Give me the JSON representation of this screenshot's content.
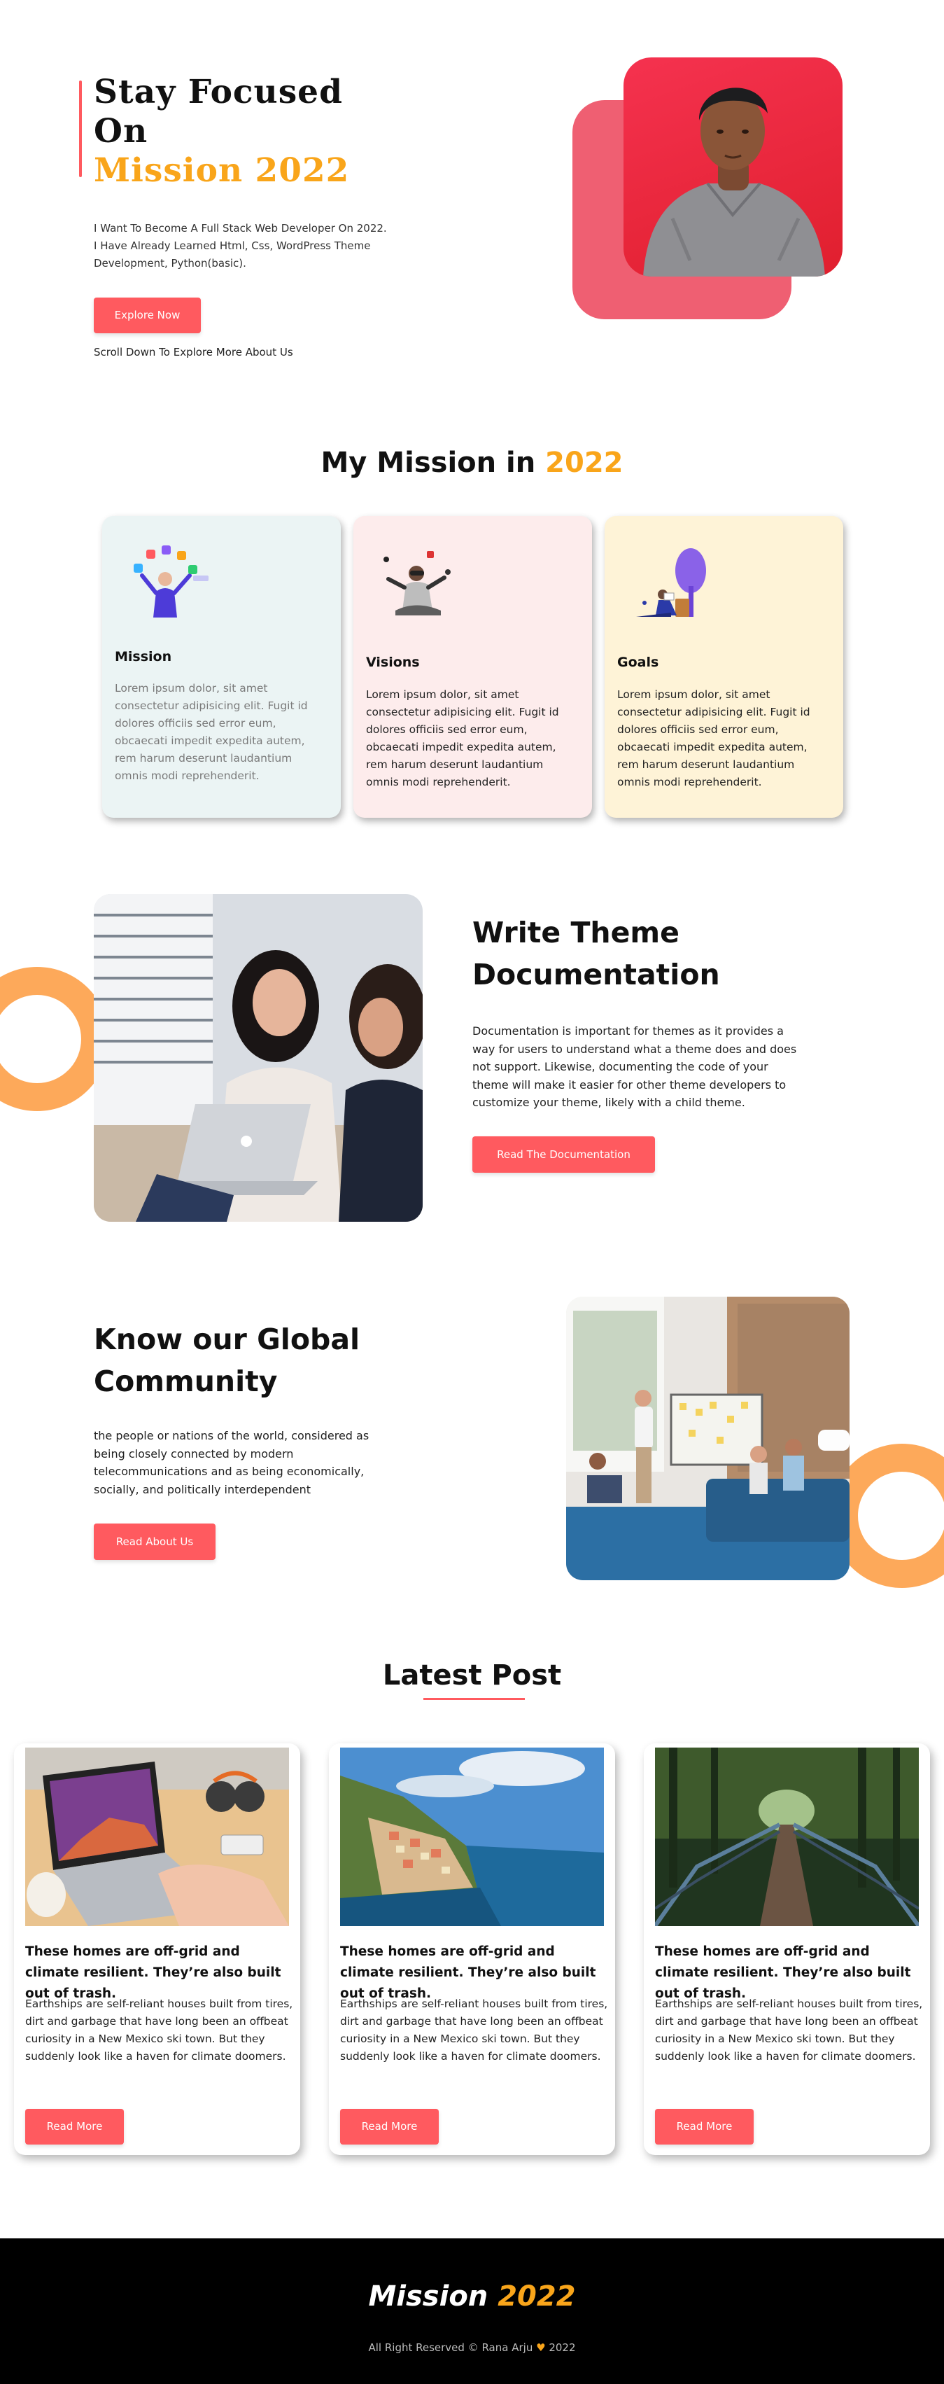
{
  "colors": {
    "accent": "#ff5a5f",
    "highlight": "#f9a51a",
    "ring": "#fda95a"
  },
  "hero": {
    "title_line1": "Stay Focused",
    "title_line2": "On",
    "title_line3": "Mission 2022",
    "description": "I Want To Become A Full Stack Web Developer On 2022. I Have Already Learned Html, Css, WordPress Theme Development, Python(basic).",
    "button_label": "Explore Now",
    "scroll_hint": "Scroll Down To Explore More About Us"
  },
  "mission": {
    "title_prefix": "My Mission in ",
    "title_accent": "2022",
    "cards": [
      {
        "title": "Mission",
        "text": "Lorem ipsum dolor, sit amet consectetur adipisicing elit. Fugit id dolores officiis sed error eum, obcaecati impedit expedita autem, rem harum deserunt laudantium omnis modi reprehenderit.",
        "icon": "juggling-apps-illustration"
      },
      {
        "title": "Visions",
        "text": "Lorem ipsum dolor, sit amet consectetur adipisicing elit. Fugit id dolores officiis sed error eum, obcaecati impedit expedita autem, rem harum deserunt laudantium omnis modi reprehenderit.",
        "icon": "vr-meditation-illustration"
      },
      {
        "title": "Goals",
        "text": "Lorem ipsum dolor, sit amet consectetur adipisicing elit. Fugit id dolores officiis sed error eum, obcaecati impedit expedita autem, rem harum deserunt laudantium omnis modi reprehenderit.",
        "icon": "tree-reading-illustration"
      }
    ]
  },
  "documentation": {
    "title": "Write Theme Documentation",
    "description": "Documentation is important for themes as it provides a way for users to understand what a theme does and does not support. Likewise, documenting the code of your theme will make it easier for other theme developers to customize your theme, likely with a child theme.",
    "button_label": "Read The Documentation"
  },
  "community": {
    "title": "Know our Global Community",
    "description": "the people or nations of the world, considered as being closely connected by modern telecommunications and as being economically, socially, and politically interdependent",
    "button_label": "Read About Us"
  },
  "latest": {
    "title": "Latest Post",
    "posts": [
      {
        "title": "These homes are off-grid and climate resilient. They’re also built out of trash.",
        "text": "Earthships are self-reliant houses built from tires, dirt and garbage that have long been an offbeat curiosity in a New Mexico ski town. But they suddenly look like a haven for climate doomers.",
        "button_label": "Read More"
      },
      {
        "title": "These homes are off-grid and climate resilient. They’re also built out of trash.",
        "text": "Earthships are self-reliant houses built from tires, dirt and garbage that have long been an offbeat curiosity in a New Mexico ski town. But they suddenly look like a haven for climate doomers.",
        "button_label": "Read More"
      },
      {
        "title": "These homes are off-grid and climate resilient. They’re also built out of trash.",
        "text": "Earthships are self-reliant houses built from tires, dirt and garbage that have long been an offbeat curiosity in a New Mexico ski town. But they suddenly look like a haven for climate doomers.",
        "button_label": "Read More"
      }
    ]
  },
  "footer": {
    "brand_word": "Mission ",
    "brand_year": "2022",
    "copyright_prefix": "All Right Reserved © Rana Arju ",
    "heart": "♥",
    "copyright_year": " 2022"
  }
}
